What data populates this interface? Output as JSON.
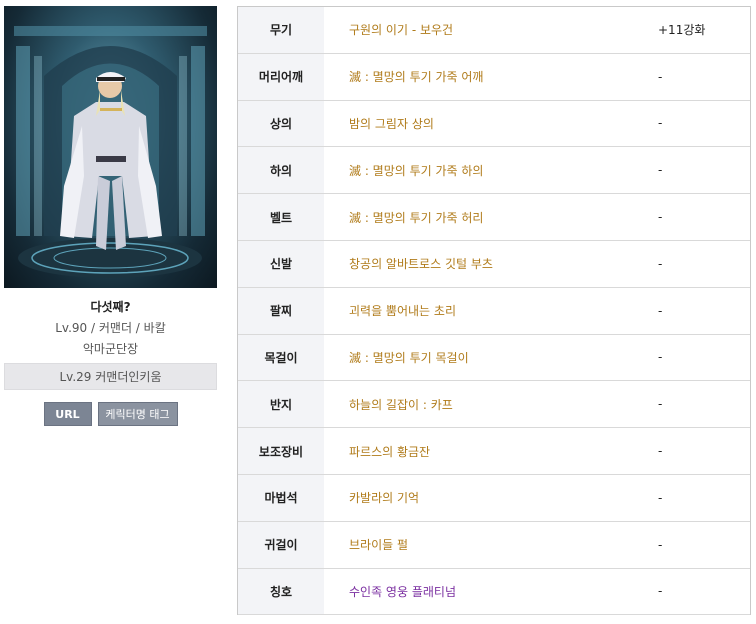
{
  "character": {
    "name": "다섯째?",
    "level_job": "Lv.90 / 커맨더 / 바칼",
    "guild": "악마군단장",
    "adventure_tag": "Lv.29 커맨더인키움"
  },
  "buttons": {
    "url": "URL",
    "name_tag": "케릭터명 태그"
  },
  "colors": {
    "item_gold": "#b07b1a",
    "item_purple": "#7a2ea0",
    "slot_bg": "#f3f4f7"
  },
  "equipment": [
    {
      "slot": "무기",
      "item": "구원의 이기 - 보우건",
      "enhance": "+11강화",
      "rarity": "epic"
    },
    {
      "slot": "머리어깨",
      "item": "滅 : 멸망의 투기 가죽 어깨",
      "enhance": "-",
      "rarity": "epic"
    },
    {
      "slot": "상의",
      "item": "밤의 그림자 상의",
      "enhance": "-",
      "rarity": "epic"
    },
    {
      "slot": "하의",
      "item": "滅 : 멸망의 투기 가죽 하의",
      "enhance": "-",
      "rarity": "epic"
    },
    {
      "slot": "벨트",
      "item": "滅 : 멸망의 투기 가죽 허리",
      "enhance": "-",
      "rarity": "epic"
    },
    {
      "slot": "신발",
      "item": "창공의 알바트로스 깃털 부츠",
      "enhance": "-",
      "rarity": "epic"
    },
    {
      "slot": "팔찌",
      "item": "괴력을 뿜어내는 초리",
      "enhance": "-",
      "rarity": "epic"
    },
    {
      "slot": "목걸이",
      "item": "滅 : 멸망의 투기 목걸이",
      "enhance": "-",
      "rarity": "epic"
    },
    {
      "slot": "반지",
      "item": "하늘의 길잡이 : 카프",
      "enhance": "-",
      "rarity": "epic"
    },
    {
      "slot": "보조장비",
      "item": "파르스의 황금잔",
      "enhance": "-",
      "rarity": "epic"
    },
    {
      "slot": "마법석",
      "item": "카발라의 기억",
      "enhance": "-",
      "rarity": "epic"
    },
    {
      "slot": "귀걸이",
      "item": "브라이들 펄",
      "enhance": "-",
      "rarity": "epic"
    },
    {
      "slot": "칭호",
      "item": "수인족 영웅 플래티넘",
      "enhance": "-",
      "rarity": "unique"
    }
  ]
}
